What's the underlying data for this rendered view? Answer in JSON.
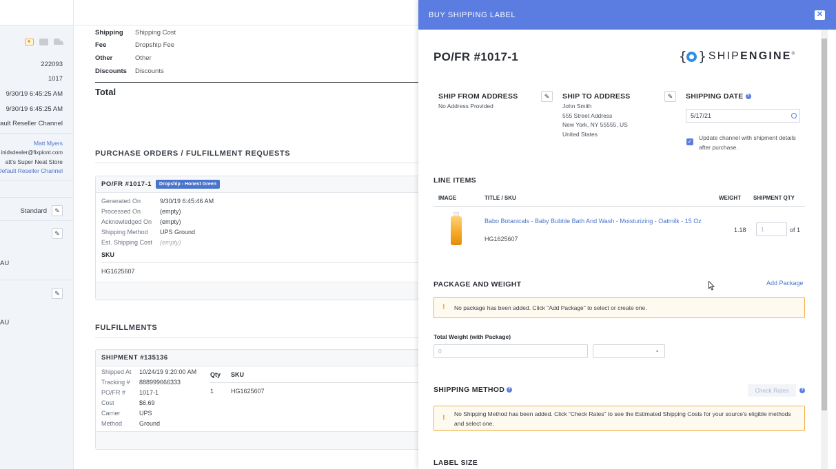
{
  "sidebar": {
    "values": [
      "222093",
      "1017",
      "9/30/19 6:45:25 AM",
      "9/30/19 6:45:25 AM",
      "fault Reseller Channel"
    ],
    "user": {
      "name": "Matt Myers",
      "email": "inidsdealer@fixpiont.com",
      "store": "att's Super Neat Store",
      "channel": "Default Reseller Channel"
    },
    "shipping_level": "Standard",
    "au_1": "AU",
    "au_2": "AU"
  },
  "main": {
    "totals": [
      {
        "key": "Shipping",
        "value": "Shipping Cost"
      },
      {
        "key": "Fee",
        "value": "Dropship Fee"
      },
      {
        "key": "Other",
        "value": "Other"
      },
      {
        "key": "Discounts",
        "value": "Discounts"
      }
    ],
    "total_label": "Total",
    "po_section_title": "PURCHASE ORDERS / FULFILLMENT REQUESTS",
    "po_card": {
      "title": "PO/FR #1017-1",
      "badge": "Dropship - Honest Green",
      "rows": [
        {
          "key": "Generated On",
          "value": "9/30/19 6:45:46 AM"
        },
        {
          "key": "Processed On",
          "value": "(empty)"
        },
        {
          "key": "Acknowledged On",
          "value": "(empty)"
        },
        {
          "key": "Shipping Method",
          "value": "UPS Ground"
        },
        {
          "key": "Est. Shipping Cost",
          "value": "(empty)"
        }
      ],
      "sku_header": "SKU",
      "sku": "HG1625607"
    },
    "fulfillments_title": "FULFILLMENTS",
    "shipment_card": {
      "title": "SHIPMENT #135136",
      "rows": [
        {
          "key": "Shipped At",
          "value": "10/24/19 9:20:00 AM"
        },
        {
          "key": "Tracking #",
          "value": "888999666333"
        },
        {
          "key": "PO/FR #",
          "value": "1017-1"
        },
        {
          "key": "Cost",
          "value": "$6.69"
        },
        {
          "key": "Carrier",
          "value": "UPS"
        },
        {
          "key": "Method",
          "value": "Ground"
        }
      ],
      "qty_header": "Qty",
      "sku_header": "SKU",
      "qty": "1",
      "sku": "HG1625607"
    }
  },
  "modal": {
    "title": "BUY SHIPPING LABEL",
    "close_icon": "close-icon",
    "po_number": "PO/FR #1017-1",
    "logo_mark": "{",
    "logo_mark_end": "}",
    "logo_text_light": "SHIP",
    "logo_text_bold": "ENGINE",
    "logo_reg": "®",
    "ship_from": {
      "heading": "SHIP FROM ADDRESS",
      "text": "No Address Provided"
    },
    "ship_to": {
      "heading": "SHIP TO ADDRESS",
      "lines": [
        "John Smith",
        "555 Street Address",
        "New York, NY 55555, US",
        "United States"
      ]
    },
    "shipping_date": {
      "heading": "SHIPPING DATE",
      "value": "5/17/21"
    },
    "update_channel": {
      "checked": true,
      "label": "Update channel with shipment details after purchase."
    },
    "line_items": {
      "heading": "LINE ITEMS",
      "headers": {
        "image": "IMAGE",
        "title": "TITLE / SKU",
        "weight": "WEIGHT",
        "qty": "SHIPMENT QTY"
      },
      "items": [
        {
          "title": "Babo Botanicals - Baby Bubble Bath And Wash - Moisturizing - Oatmilk - 15 Oz",
          "sku": "HG1625607",
          "weight": "1.18",
          "qty_placeholder": "1",
          "qty_of": "of 1"
        }
      ]
    },
    "package": {
      "heading": "PACKAGE AND WEIGHT",
      "add_label": "Add Package",
      "warning": "No package has been added. Click \"Add Package\" to select or create one.",
      "total_weight_label": "Total Weight (with Package)",
      "total_weight_placeholder": "0"
    },
    "shipping_method": {
      "heading": "SHIPPING METHOD",
      "check_rates_label": "Check Rates",
      "warning": "No Shipping Method has been added. Click \"Check Rates\" to see the Estimated Shipping Costs for your source's eligible methods and select one."
    },
    "label_size": {
      "heading": "LABEL SIZE"
    }
  },
  "colors": {
    "modal_header": "#5b7de1",
    "link": "#4a74c9",
    "warning_border": "#f0b24a",
    "badge": "#4a74c9"
  }
}
